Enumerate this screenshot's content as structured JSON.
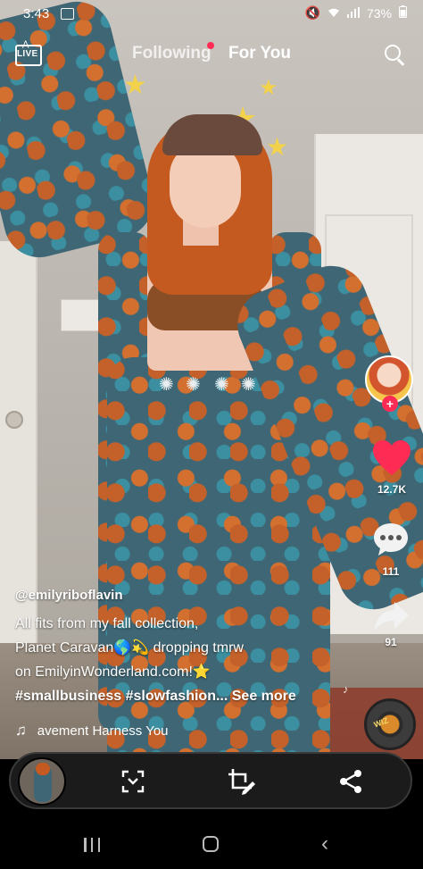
{
  "status_bar": {
    "time": "3:43",
    "battery": "73%",
    "icons": [
      "image-icon",
      "mute-icon",
      "wifi-icon",
      "signal-icon",
      "battery-icon"
    ]
  },
  "top_nav": {
    "live_label": "LIVE",
    "tabs": [
      {
        "label": "Following",
        "active": false,
        "has_notification_dot": true
      },
      {
        "label": "For You",
        "active": true
      }
    ],
    "search_icon": "search-icon"
  },
  "actions": {
    "likes": "12.7K",
    "comments": "111",
    "shares": "91",
    "follow_icon": "plus-icon"
  },
  "caption": {
    "username": "@emilyriboflavin",
    "lines": [
      "All fits from my fall collection,",
      "Planet Caravan🌎💫 dropping tmrw",
      "on EmilyinWonderland.com!⭐"
    ],
    "hashtags": "#smallbusiness #slowfashion... See more"
  },
  "music": {
    "text": "avement    Harness You"
  },
  "bottom_toolbar": {
    "buttons": [
      "scan-icon",
      "crop-edit-icon",
      "share-icon"
    ]
  },
  "colors": {
    "accent": "#fe2c55",
    "toolbar_bg": "#1b1b1b",
    "text": "#ffffff"
  }
}
